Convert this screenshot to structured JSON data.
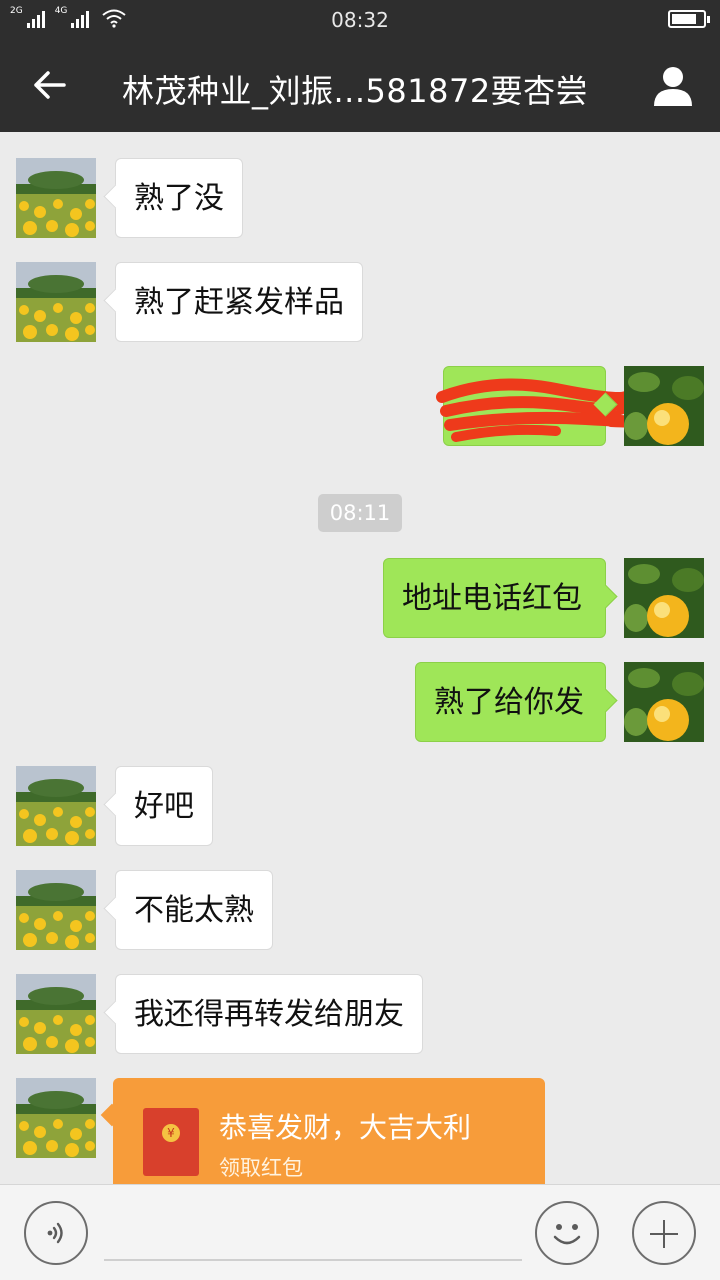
{
  "status_bar": {
    "network_1": "2G",
    "network_2": "4G",
    "time": "08:32",
    "icons": [
      "signal-icon",
      "wifi-icon",
      "battery-icon"
    ]
  },
  "header": {
    "title": "林茂种业_刘振...581872要杏尝",
    "icons": [
      "back-arrow-icon",
      "profile-icon"
    ]
  },
  "messages": [
    {
      "side": "left",
      "text": "熟了没"
    },
    {
      "side": "left",
      "text": "熟了赶紧发样品"
    },
    {
      "side": "right",
      "text": "",
      "redacted": true
    },
    {
      "type": "timestamp",
      "text": "08:11"
    },
    {
      "side": "right",
      "text": "地址电话红包"
    },
    {
      "side": "right",
      "text": "熟了给你发"
    },
    {
      "side": "left",
      "text": "好吧"
    },
    {
      "side": "left",
      "text": "不能太熟"
    },
    {
      "side": "left",
      "text": "我还得再转发给朋友"
    },
    {
      "side": "left",
      "type": "red-packet",
      "title": "恭喜发财，大吉大利",
      "subtitle": "领取红包"
    }
  ],
  "input_bar": {
    "icons": [
      "voice-icon",
      "emoji-icon",
      "plus-icon"
    ]
  },
  "colors": {
    "header_bg": "#2e2e2e",
    "chat_bg": "#ebebeb",
    "sent_bubble": "#9fe658",
    "received_bubble": "#ffffff",
    "red_packet": "#f79c3a"
  }
}
